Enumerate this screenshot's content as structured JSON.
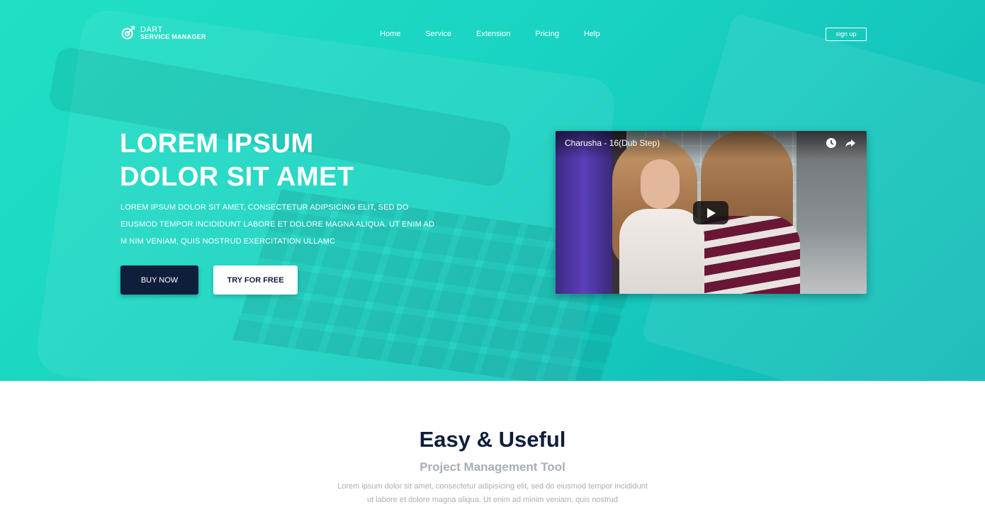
{
  "brand": {
    "line1": "DART",
    "line2": "SERVICE MANAGER",
    "icon": "dart-logo-icon"
  },
  "nav": {
    "items": [
      "Home",
      "Service",
      "Extension",
      "Pricing",
      "Help"
    ],
    "signup_label": "sign up"
  },
  "hero": {
    "title_line1": "LOREM IPSUM",
    "title_line2": "DOLOR SIT AMET",
    "description": "LOREM IPSUM DOLOR SIT AMET, CONSECTETUR ADIPSICING ELIT, SED DO EIUSMOD TEMPOR INCIDIDUNT LABORE ET DOLORE MAGNA ALIQUA. UT ENIM AD M NIM VENIAM, QUIS NOSTRUD EXERCITATION ULLAMC",
    "buy_label": "BUY NOW",
    "try_label": "TRY FOR FREE",
    "colors": {
      "gradient_start": "#1fe0c4",
      "gradient_end": "#10b8b7",
      "dark": "#0f1e3a"
    }
  },
  "video": {
    "title": "Charusha - 16(Dub Step)",
    "watch_later_icon": "clock-icon",
    "share_icon": "share-icon",
    "play_icon": "play-icon"
  },
  "features": {
    "title": "Easy & Useful",
    "subtitle": "Project Management Tool",
    "text": "Lorem ipsum dolor sit amet, consectetur adipisicing elit, sed do eiusmod tempor incididunt ut labore et dolore magna aliqua. Ut enim ad minim veniam, quis nostrud"
  }
}
